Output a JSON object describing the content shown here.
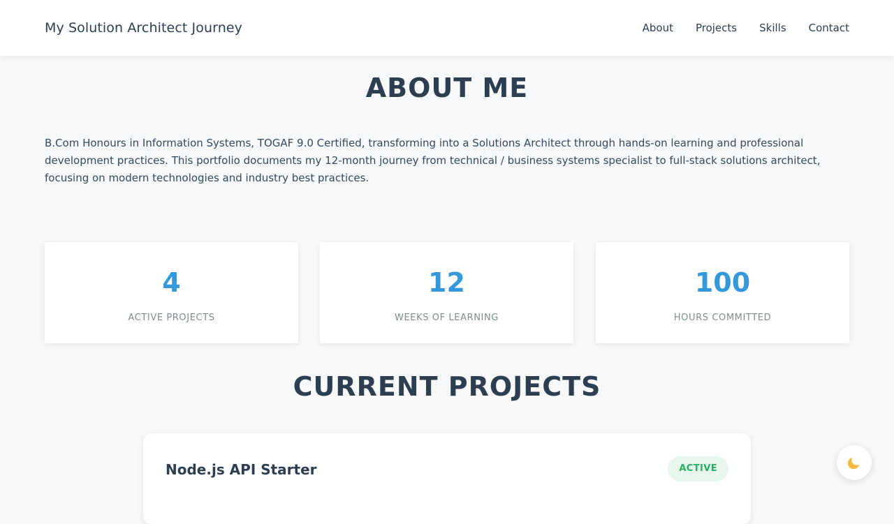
{
  "header": {
    "brand": "My Solution Architect Journey",
    "nav": [
      "About",
      "Projects",
      "Skills",
      "Contact"
    ]
  },
  "about": {
    "title": "ABOUT ME",
    "text": "B.Com Honours in Information Systems, TOGAF 9.0 Certified, transforming into a Solutions Architect through hands-on learning and professional development practices. This portfolio documents my 12-month journey from technical / business systems specialist to full-stack solutions architect, focusing on modern technologies and industry best practices."
  },
  "stats": [
    {
      "value": "4",
      "label": "ACTIVE PROJECTS"
    },
    {
      "value": "12",
      "label": "WEEKS OF LEARNING"
    },
    {
      "value": "100",
      "label": "HOURS COMMITTED"
    }
  ],
  "projects": {
    "title": "CURRENT PROJECTS",
    "items": [
      {
        "name": "Node.js API Starter",
        "status": "ACTIVE"
      }
    ]
  },
  "theme_toggle": {
    "icon": "moon-icon"
  },
  "colors": {
    "accent": "#3498db",
    "text": "#2c3e50",
    "active_badge_bg": "#e8f6ee",
    "active_badge_text": "#27ae60"
  }
}
